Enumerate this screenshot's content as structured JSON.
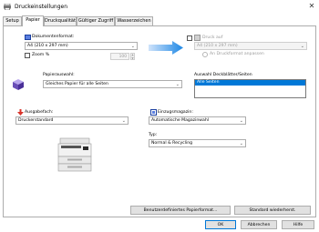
{
  "window": {
    "title": "Druckeinstellungen"
  },
  "tabs": [
    "Setup",
    "Papier",
    "Druckqualität",
    "Gültiger Zugriff",
    "Wasserzeichen"
  ],
  "active_tab": "Papier",
  "document_format": {
    "label": "Dokumentenformat:",
    "value": "A4 (210 x 297 mm)",
    "zoom_label": "Zoom %",
    "zoom_value": "100"
  },
  "print_on": {
    "label": "Druck auf",
    "value": "A4 (210 x 297 mm)",
    "fit_label": "An Druckformat anpassen"
  },
  "paper_selection": {
    "label": "Papierauswahl:",
    "value": "Gleiches Papier für alle Seiten"
  },
  "cover_selection": {
    "label": "Auswahl Deckblätter/Seiten",
    "items": [
      "Alle Seiten"
    ]
  },
  "output_tray": {
    "label": "Ausgabefach:",
    "value": "Druckerstandard"
  },
  "input_tray": {
    "label": "Einzugsmagazin:",
    "value": "Automatische Magazinwahl"
  },
  "paper_type": {
    "label": "Typ:",
    "value": "Normal & Recycling"
  },
  "buttons": {
    "custom_paper": "Benutzerdefiniertes Papierformat...",
    "restore_defaults": "Standard wiederherst.",
    "ok": "OK",
    "cancel": "Abbrechen",
    "help": "Hilfe"
  },
  "colors": {
    "accent": "#0078d7",
    "arrow_blue": "#1e88e5",
    "cube_purple": "#6a4fb8",
    "tray_red": "#d9342b"
  }
}
